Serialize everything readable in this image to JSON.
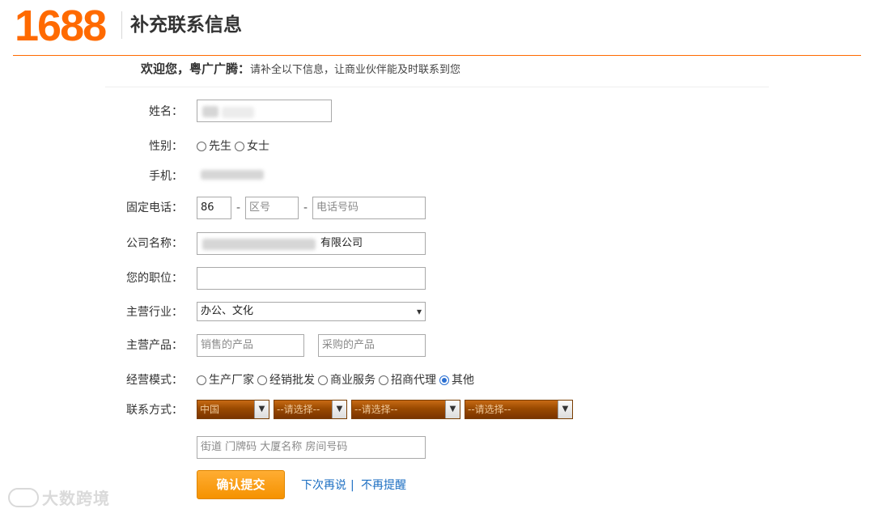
{
  "header": {
    "logo": "1688",
    "title": "补充联系信息"
  },
  "welcome": {
    "greeting": "欢迎您，粤广广腾：",
    "message": "请补全以下信息，让商业伙伴能及时联系到您"
  },
  "form": {
    "name": {
      "label": "姓名："
    },
    "gender": {
      "label": "性别：",
      "options": [
        "先生",
        "女士"
      ],
      "selected": ""
    },
    "mobile": {
      "label": "手机："
    },
    "landline": {
      "label": "固定电话：",
      "country_code": "86",
      "area_placeholder": "区号",
      "number_placeholder": "电话号码",
      "separator": "-"
    },
    "company": {
      "label": "公司名称：",
      "value_suffix": "有限公司"
    },
    "position": {
      "label": "您的职位：",
      "value": ""
    },
    "industry": {
      "label": "主营行业：",
      "value": "办公、文化"
    },
    "products": {
      "label": "主营产品：",
      "sell_placeholder": "销售的产品",
      "buy_placeholder": "采购的产品"
    },
    "business_mode": {
      "label": "经营模式：",
      "options": [
        "生产厂家",
        "经销批发",
        "商业服务",
        "招商代理",
        "其他"
      ],
      "selected": "其他"
    },
    "contact": {
      "label": "联系方式：",
      "country": "中国",
      "province": "--请选择--",
      "city": "--请选择--",
      "district": "--请选择--",
      "address_placeholder": "街道 门牌码 大厦名称 房间号码"
    }
  },
  "actions": {
    "submit": "确认提交",
    "later": "下次再说",
    "separator": "|",
    "never": "不再提醒"
  },
  "watermark": {
    "text": "大数跨境"
  },
  "colors": {
    "brand": "#ff6a00",
    "submit": "#f59200",
    "link": "#1b6ec2",
    "dropdown": "#9a4a00"
  }
}
